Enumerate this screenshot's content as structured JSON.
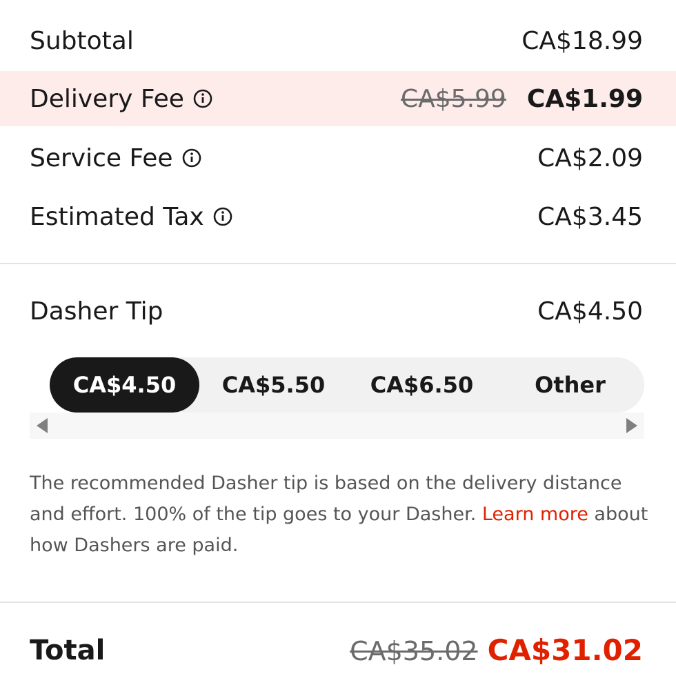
{
  "summary": {
    "subtotal": {
      "label": "Subtotal",
      "value": "CA$18.99"
    },
    "delivery_fee": {
      "label": "Delivery Fee",
      "original": "CA$5.99",
      "value": "CA$1.99"
    },
    "service_fee": {
      "label": "Service Fee",
      "value": "CA$2.09"
    },
    "estimated_tax": {
      "label": "Estimated Tax",
      "value": "CA$3.45"
    }
  },
  "tip": {
    "label": "Dasher Tip",
    "value": "CA$4.50",
    "options": [
      {
        "label": "CA$4.50",
        "selected": true
      },
      {
        "label": "CA$5.50",
        "selected": false
      },
      {
        "label": "CA$6.50",
        "selected": false
      },
      {
        "label": "Other",
        "selected": false
      }
    ],
    "note_before": "The recommended Dasher tip is based on the delivery distance and effort. 100% of the tip goes to your Dasher. ",
    "note_link": "Learn more",
    "note_after": " about how Dashers are paid."
  },
  "total": {
    "label": "Total",
    "original": "CA$35.02",
    "value": "CA$31.02"
  },
  "colors": {
    "accent": "#e02100",
    "highlight_bg": "#fdecea",
    "selected_tip_bg": "#191919"
  },
  "icons": {
    "info": "info-circle-icon",
    "scroll_left": "triangle-left-icon",
    "scroll_right": "triangle-right-icon"
  }
}
